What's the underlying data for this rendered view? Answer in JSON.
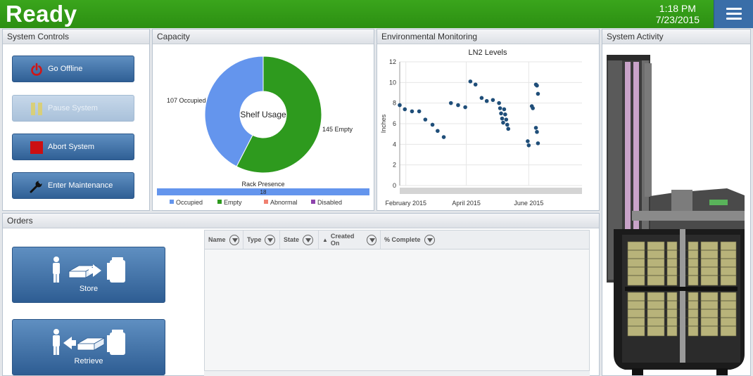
{
  "header": {
    "status": "Ready",
    "time": "1:18 PM",
    "date": "7/23/2015",
    "menu_icon": "hamburger-menu-icon"
  },
  "system_controls": {
    "title": "System Controls",
    "buttons": [
      {
        "label": "Go Offline",
        "icon": "power-icon",
        "disabled": false
      },
      {
        "label": "Pause System",
        "icon": "pause-icon",
        "disabled": true
      },
      {
        "label": "Abort System",
        "icon": "stop-icon",
        "disabled": false
      },
      {
        "label": "Enter Maintenance",
        "icon": "wrench-icon",
        "disabled": false
      }
    ]
  },
  "capacity": {
    "title": "Capacity",
    "chart_data": {
      "type": "pie",
      "title": "Shelf Usage",
      "slices": [
        {
          "label": "107 Occupied",
          "name": "Occupied",
          "value": 107,
          "color": "#6495ed"
        },
        {
          "label": "145 Empty",
          "name": "Empty",
          "value": 145,
          "color": "#2e9a1e"
        }
      ],
      "legend": [
        {
          "name": "Occupied",
          "color": "#6495ed"
        },
        {
          "name": "Empty",
          "color": "#2e9a1e"
        },
        {
          "name": "Abnormal",
          "color": "#f08070"
        },
        {
          "name": "Disabled",
          "color": "#8e44ad"
        }
      ],
      "rack_presence": {
        "label": "Rack Presence",
        "value": 18,
        "fraction": 1.0,
        "color": "#6495ed"
      }
    }
  },
  "environmental": {
    "title": "Environmental Monitoring",
    "chart_data": {
      "type": "scatter",
      "title": "LN2 Levels",
      "ylabel": "Inches",
      "ylim": [
        0,
        12
      ],
      "yticks": [
        0,
        2,
        4,
        6,
        8,
        10,
        12
      ],
      "xlim": [
        "2015-01-26",
        "2015-07-23"
      ],
      "xticks": [
        {
          "label": "February 2015",
          "date": "2015-02-01"
        },
        {
          "label": "April 2015",
          "date": "2015-04-01"
        },
        {
          "label": "June 2015",
          "date": "2015-06-01"
        }
      ],
      "color": "#1f4e79",
      "points": [
        {
          "x": "2015-01-26",
          "y": 7.8
        },
        {
          "x": "2015-01-31",
          "y": 7.4
        },
        {
          "x": "2015-02-07",
          "y": 7.2
        },
        {
          "x": "2015-02-14",
          "y": 7.2
        },
        {
          "x": "2015-02-20",
          "y": 6.4
        },
        {
          "x": "2015-02-27",
          "y": 5.9
        },
        {
          "x": "2015-03-04",
          "y": 5.3
        },
        {
          "x": "2015-03-10",
          "y": 4.7
        },
        {
          "x": "2015-03-17",
          "y": 8.0
        },
        {
          "x": "2015-03-24",
          "y": 7.8
        },
        {
          "x": "2015-03-31",
          "y": 7.6
        },
        {
          "x": "2015-04-05",
          "y": 10.1
        },
        {
          "x": "2015-04-10",
          "y": 9.8
        },
        {
          "x": "2015-04-16",
          "y": 8.5
        },
        {
          "x": "2015-04-21",
          "y": 8.2
        },
        {
          "x": "2015-04-27",
          "y": 8.3
        },
        {
          "x": "2015-05-03",
          "y": 8.0
        },
        {
          "x": "2015-05-04",
          "y": 7.5
        },
        {
          "x": "2015-05-05",
          "y": 7.0
        },
        {
          "x": "2015-05-06",
          "y": 6.5
        },
        {
          "x": "2015-05-07",
          "y": 6.1
        },
        {
          "x": "2015-05-08",
          "y": 7.4
        },
        {
          "x": "2015-05-09",
          "y": 6.9
        },
        {
          "x": "2015-05-10",
          "y": 6.4
        },
        {
          "x": "2015-05-11",
          "y": 5.9
        },
        {
          "x": "2015-05-12",
          "y": 5.5
        },
        {
          "x": "2015-05-31",
          "y": 4.3
        },
        {
          "x": "2015-06-01",
          "y": 3.9
        },
        {
          "x": "2015-06-04",
          "y": 7.7
        },
        {
          "x": "2015-06-05",
          "y": 7.5
        },
        {
          "x": "2015-06-08",
          "y": 9.8
        },
        {
          "x": "2015-06-09",
          "y": 9.7
        },
        {
          "x": "2015-06-10",
          "y": 8.9
        },
        {
          "x": "2015-06-08",
          "y": 5.6
        },
        {
          "x": "2015-06-09",
          "y": 5.2
        },
        {
          "x": "2015-06-10",
          "y": 4.1
        }
      ]
    }
  },
  "system_activity": {
    "title": "System Activity"
  },
  "orders": {
    "title": "Orders",
    "store_label": "Store",
    "retrieve_label": "Retrieve",
    "columns": [
      "Name",
      "Type",
      "State",
      "Created On",
      "% Complete"
    ]
  }
}
